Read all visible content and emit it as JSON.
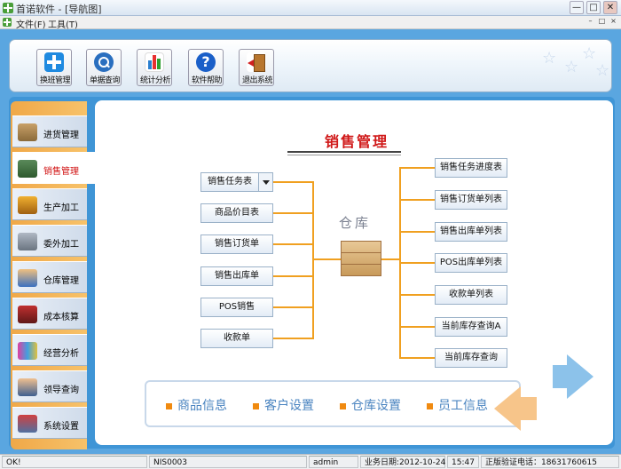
{
  "window": {
    "title": "首诺软件 - [导航图]",
    "controls": [
      "—",
      "□",
      "✕"
    ]
  },
  "menubar": {
    "items": [
      "文件(F)",
      "工具(T)"
    ],
    "mdi_controls": [
      "–",
      "□",
      "×"
    ]
  },
  "toolbar": {
    "buttons": [
      {
        "label": "换班管理",
        "icon": "plus-icon"
      },
      {
        "label": "单据查询",
        "icon": "search-icon"
      },
      {
        "label": "统计分析",
        "icon": "chart-icon"
      },
      {
        "label": "软件帮助",
        "icon": "help-icon",
        "glyph": "?"
      },
      {
        "label": "退出系统",
        "icon": "exit-icon"
      }
    ]
  },
  "sidebar": {
    "items": [
      {
        "label": "进货管理",
        "icon": "truck-icon",
        "active": false
      },
      {
        "label": "销售管理",
        "icon": "delivery-truck-icon",
        "active": true
      },
      {
        "label": "生产加工",
        "icon": "forklift-icon",
        "active": false
      },
      {
        "label": "委外加工",
        "icon": "van-icon",
        "active": false
      },
      {
        "label": "仓库管理",
        "icon": "users-icon",
        "active": false
      },
      {
        "label": "成本核算",
        "icon": "book-icon",
        "active": false
      },
      {
        "label": "经营分析",
        "icon": "chart-icon",
        "active": false
      },
      {
        "label": "领导查询",
        "icon": "leader-icon",
        "active": false
      },
      {
        "label": "系统设置",
        "icon": "tools-icon",
        "active": false
      }
    ]
  },
  "diagram": {
    "title": "销售管理",
    "center_label": "仓库",
    "left_nodes": [
      "销售任务表",
      "商品价目表",
      "销售订货单",
      "销售出库单",
      "POS销售",
      "收款单"
    ],
    "right_nodes": [
      "销售任务进度表",
      "销售订货单列表",
      "销售出库单列表",
      "POS出库单列表",
      "收款单列表",
      "当前库存查询A",
      "当前库存查询"
    ]
  },
  "quick_links": [
    "商品信息",
    "客户设置",
    "仓库设置",
    "员工信息"
  ],
  "statusbar": {
    "cells": [
      "OK!",
      "NIS0003",
      "admin",
      "业务日期:2012-10-24",
      "15:47",
      "正版验证电话：18631760615"
    ]
  },
  "colors": {
    "accent_orange": "#f0a020",
    "title_red": "#d01818",
    "link_blue": "#4a84c0",
    "background_blue": "#5aa6e0"
  }
}
